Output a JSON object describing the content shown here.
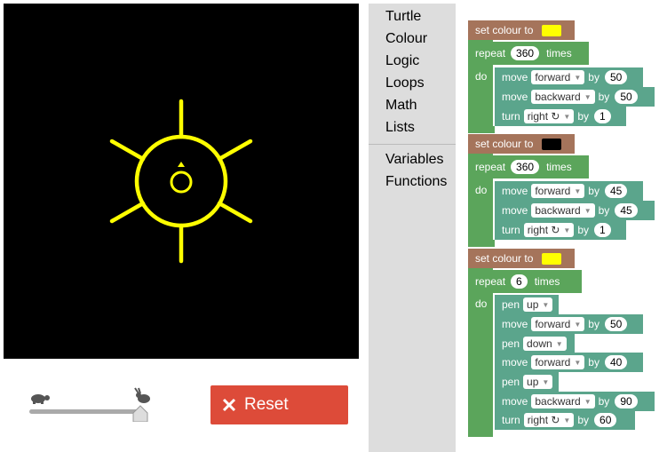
{
  "toolbox": {
    "categories": [
      "Turtle",
      "Colour",
      "Logic",
      "Loops",
      "Math",
      "Lists",
      "Variables",
      "Functions"
    ]
  },
  "reset": {
    "label": "Reset"
  },
  "workspace": {
    "set_colour_label": "set colour to",
    "repeat_label": "repeat",
    "times_label": "times",
    "do_label": "do",
    "move_label": "move",
    "by_label": "by",
    "turn_label": "turn",
    "pen_label": "pen",
    "colour1": "#ffff00",
    "colour2": "#000000",
    "colour3": "#ffff00",
    "repeat1": "360",
    "repeat2": "360",
    "repeat3": "6",
    "b1_dir1": "forward",
    "b1_val1": "50",
    "b1_dir2": "backward",
    "b1_val2": "50",
    "b1_turn": "right ↻",
    "b1_val3": "1",
    "b2_dir1": "forward",
    "b2_val1": "45",
    "b2_dir2": "backward",
    "b2_val2": "45",
    "b2_turn": "right ↻",
    "b2_val3": "1",
    "b3_pen1": "up",
    "b3_dir1": "forward",
    "b3_val1": "50",
    "b3_pen2": "down",
    "b3_dir2": "forward",
    "b3_val2": "40",
    "b3_pen3": "up",
    "b3_dir3": "backward",
    "b3_val3": "90",
    "b3_turn": "right ↻",
    "b3_val4": "60"
  },
  "colors": {
    "turtle_line": "#ffff00",
    "canvas_bg": "#000000",
    "reset_bg": "#dd4b39"
  }
}
